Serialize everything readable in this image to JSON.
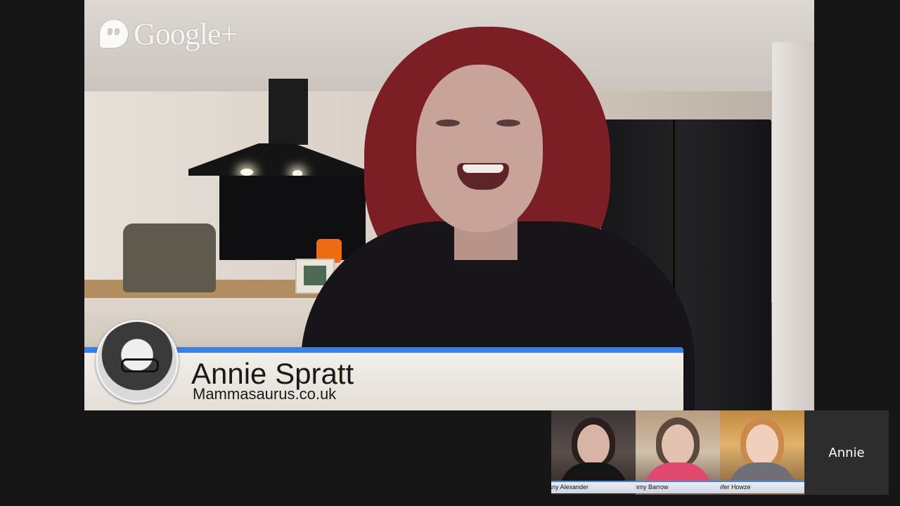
{
  "watermark": {
    "brand": "Google+",
    "icon": "google-plus-hangout-icon"
  },
  "main_speaker": {
    "name": "Annie Spratt",
    "website": "Mammasaurus.co.uk"
  },
  "participants": [
    {
      "label": "any Alexander"
    },
    {
      "label": "mmy Barrow"
    },
    {
      "label": "nifer Howze"
    }
  ],
  "self_view": {
    "label": "Annie"
  },
  "colors": {
    "lower_third_accent": "#3a82e2",
    "background": "#161616"
  }
}
